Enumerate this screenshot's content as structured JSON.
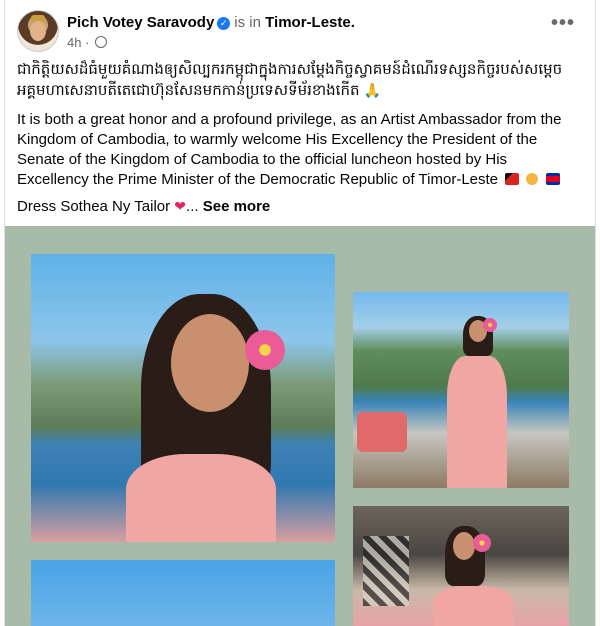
{
  "post": {
    "author": "Pich Votey Saravody",
    "is_in": "is in",
    "location": "Timor-Leste.",
    "time": "4h",
    "khmer_text": "ជាកិត្តិយសដ៏ធំមួយគំណាងឲ្យសិល្បករកម្ពុជាក្នុងការសម្តែងកិច្ចស្វាគមន៍ដំណើរទស្សនកិច្ចរបស់សម្តេចអគ្គមហាសេនាបតីតេជោហ៊ុនសែនមកកាន់ប្រទេសទីម័រខាងកើត",
    "english_text": "It is both a great honor and a profound privilege, as an Artist Ambassador from the Kingdom of Cambodia, to warmly welcome His Excellency the President of the Senate of the Kingdom of Cambodia to the official luncheon hosted by His Excellency the Prime Minister of the Democratic Republic of Timor-Leste",
    "dress_text": "Dress Sothea Ny Tailor",
    "ellipsis": "...",
    "see_more": "See more",
    "more_glyph": "•••",
    "verified_glyph": "✓",
    "icons": [
      "verified-badge-icon",
      "globe-icon",
      "more-options-icon",
      "pray-emoji-icon",
      "flag-timor-leste-icon",
      "handshake-emoji-icon",
      "flag-cambodia-icon",
      "heart-emoji-icon"
    ]
  },
  "colors": {
    "verified": "#1877f2",
    "muted": "#65676b",
    "gallery_bg": "#a8bba8"
  }
}
